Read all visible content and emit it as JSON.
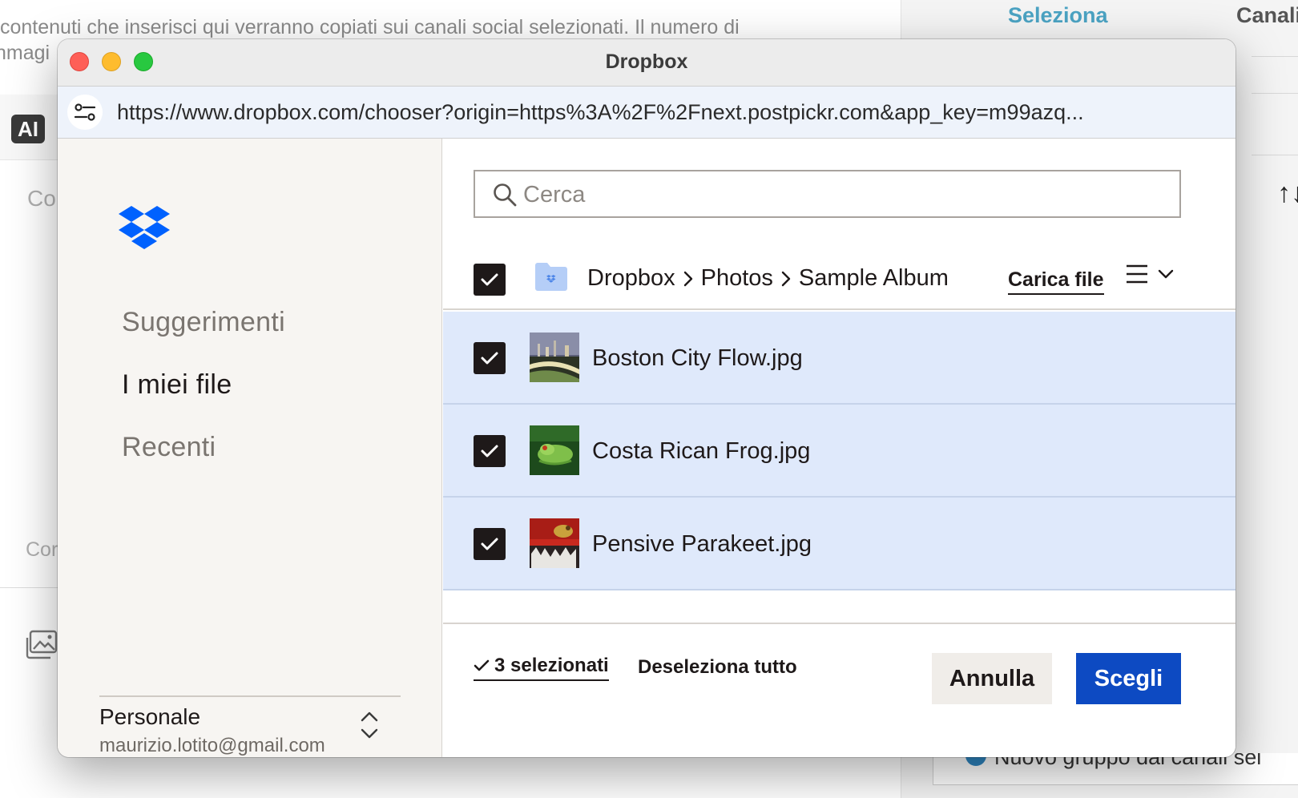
{
  "background": {
    "description_line1": "contenuti che inserisci qui verranno copiati sui canali social selezionati. Il numero di",
    "description_line2": "nmagi",
    "ai_badge": "AI",
    "label_co1": "Co",
    "label_co2": "Cor",
    "tab_select": "Seleziona",
    "tab_channels": "Canali",
    "new_group": "Nuovo gruppo dai canali sel",
    "sort_glyph": "↑↓"
  },
  "window": {
    "title": "Dropbox",
    "url": "https://www.dropbox.com/chooser?origin=https%3A%2F%2Fnext.postpickr.com&app_key=m99azq..."
  },
  "sidebar": {
    "items": [
      {
        "label": "Suggerimenti"
      },
      {
        "label": "I miei file"
      },
      {
        "label": "Recenti"
      }
    ],
    "account": {
      "name": "Personale",
      "email": "maurizio.lotito@gmail.com"
    }
  },
  "main": {
    "search_placeholder": "Cerca",
    "breadcrumb": [
      "Dropbox",
      "Photos",
      "Sample Album"
    ],
    "upload_label": "Carica file",
    "files": [
      {
        "name": "Boston City Flow.jpg",
        "checked": true
      },
      {
        "name": "Costa Rican Frog.jpg",
        "checked": true
      },
      {
        "name": "Pensive Parakeet.jpg",
        "checked": true
      }
    ],
    "footer": {
      "selected_count": "3 selezionati",
      "deselect_all": "Deseleziona tutto",
      "cancel": "Annulla",
      "choose": "Scegli"
    }
  },
  "colors": {
    "selected_row": "#dfe9fb",
    "primary_button": "#0d4ac2",
    "dropbox_blue": "#0061fe"
  }
}
